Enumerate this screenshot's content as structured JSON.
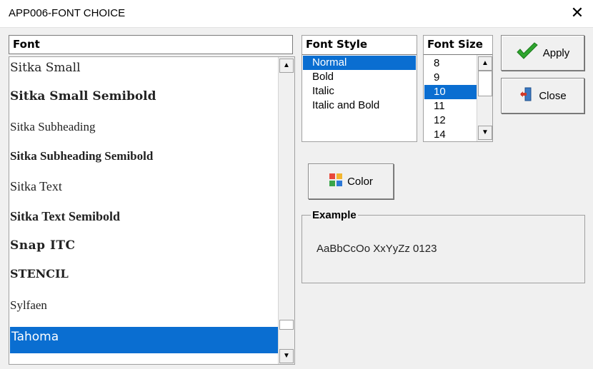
{
  "window": {
    "title": "APP006-FONT CHOICE"
  },
  "font_panel": {
    "header": "Font",
    "items": [
      "Sitka Small",
      "Sitka Small Semibold",
      "Sitka Subheading",
      "Sitka Subheading Semibold",
      "Sitka Text",
      "Sitka Text Semibold",
      "Snap ITC",
      "STENCIL",
      "Sylfaen",
      "Tahoma"
    ],
    "selected": "Tahoma"
  },
  "style_panel": {
    "header": "Font Style",
    "items": [
      "Normal",
      "Bold",
      "Italic",
      "Italic and Bold"
    ],
    "selected": "Normal"
  },
  "size_panel": {
    "header": "Font Size",
    "items": [
      "8",
      "9",
      "10",
      "11",
      "12",
      "14"
    ],
    "selected": "10"
  },
  "buttons": {
    "apply": "Apply",
    "close": "Close",
    "color": "Color"
  },
  "example": {
    "legend": "Example",
    "sample": "AaBbCcOo XxYyZz 0123"
  },
  "colors": {
    "selection": "#0a6ed1",
    "check": "#2fa52f"
  }
}
